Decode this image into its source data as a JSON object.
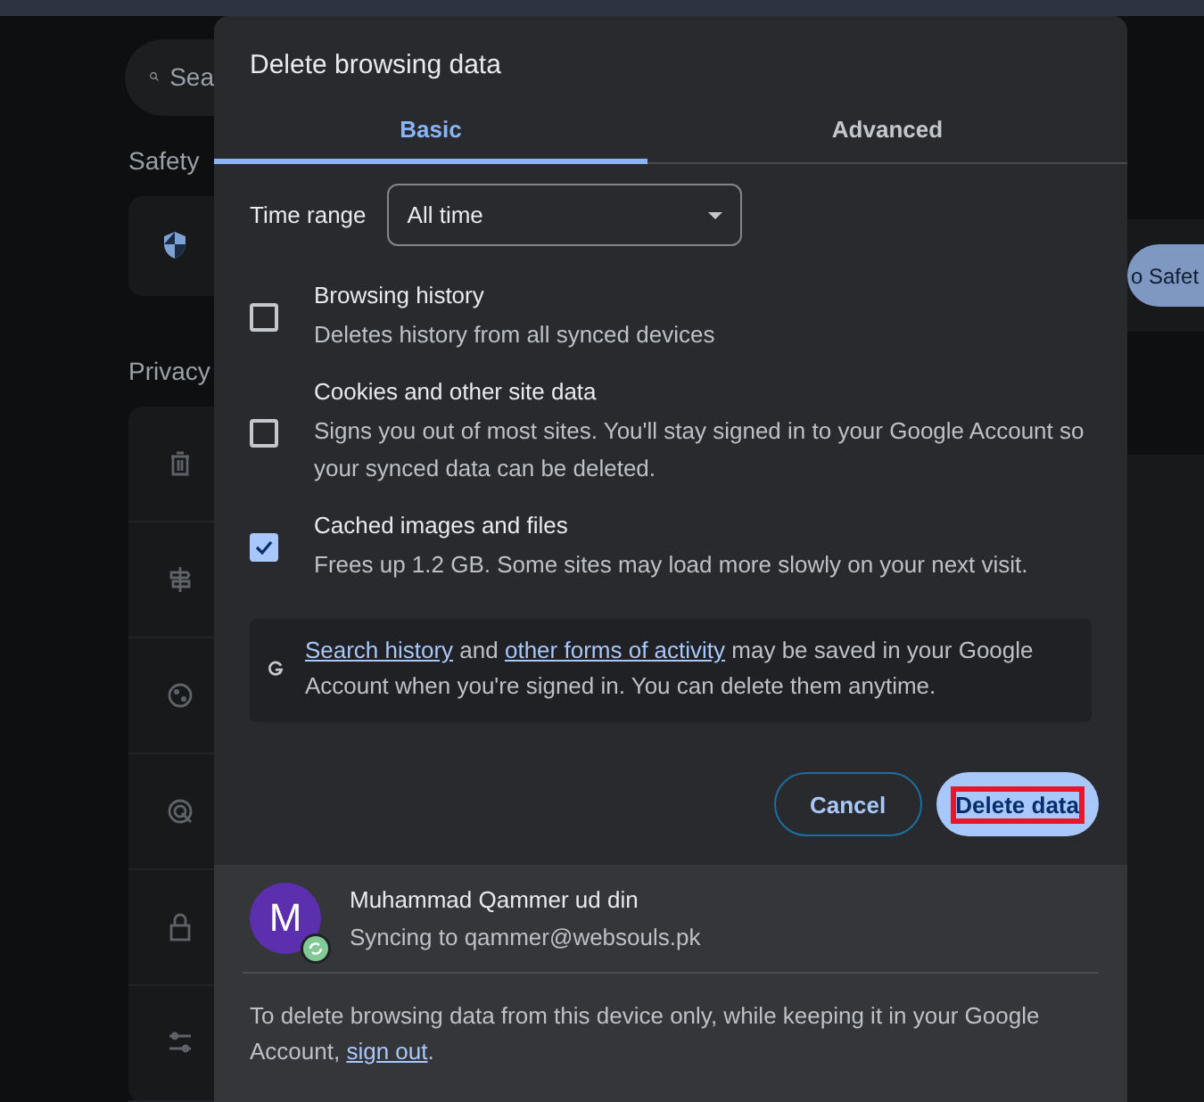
{
  "background": {
    "search": {
      "placeholder": "Sea"
    },
    "safety_heading": "Safety",
    "safety_button": "o Safet",
    "privacy_heading": "Privacy"
  },
  "dialog": {
    "title": "Delete browsing data",
    "tabs": [
      {
        "label": "Basic",
        "selected": true
      },
      {
        "label": "Advanced",
        "selected": false
      }
    ],
    "time_range": {
      "label": "Time range",
      "value": "All time"
    },
    "items": [
      {
        "title": "Browsing history",
        "description": "Deletes history from all synced devices",
        "checked": false
      },
      {
        "title": "Cookies and other site data",
        "description": "Signs you out of most sites. You'll stay signed in to your Google Account so your synced data can be deleted.",
        "checked": false
      },
      {
        "title": "Cached images and files",
        "description": "Frees up 1.2 GB. Some sites may load more slowly on your next visit.",
        "checked": true
      }
    ],
    "notice": {
      "link_1": "Search history",
      "text_1": "and",
      "link_2": "other forms of activity",
      "text_2": "may be saved in your Google Account when you're signed in. You can delete them anytime."
    },
    "buttons": [
      {
        "label": "Cancel",
        "kind": "secondary",
        "highlighted": false
      },
      {
        "label": "Delete data",
        "kind": "primary",
        "highlighted": true
      }
    ],
    "account": {
      "initial": "M",
      "name": "Muhammad Qammer ud din",
      "status": "Syncing to qammer@websouls.pk"
    },
    "footer": {
      "text": "To delete browsing data from this device only, while keeping it in your Google Account,",
      "link": "sign out",
      "end": "."
    }
  }
}
